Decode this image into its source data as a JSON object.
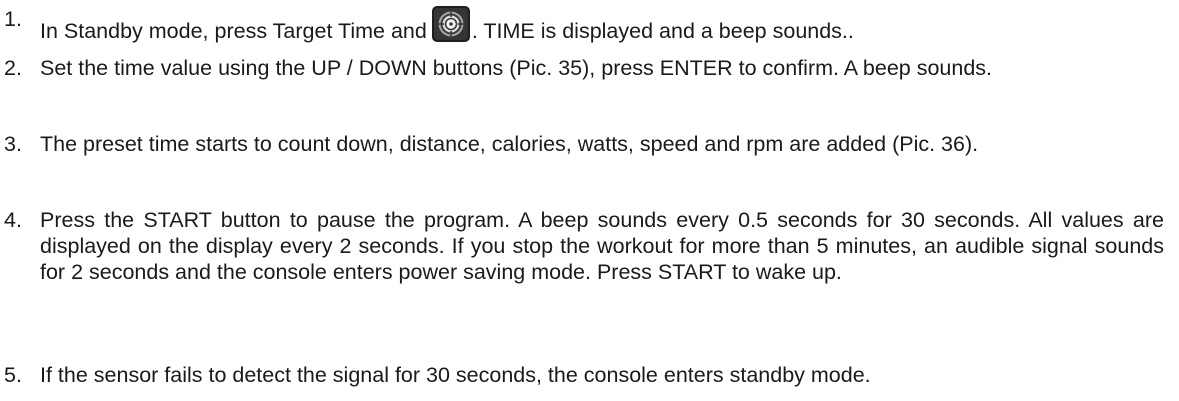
{
  "steps": [
    {
      "num": "1.",
      "text_before": "In Standby mode, press Target Time and",
      "icon": "target-button-icon",
      "text_after": ". TIME is displayed and a beep sounds.."
    },
    {
      "num": "2.",
      "text": "Set the time value using the UP / DOWN buttons (Pic. 35), press ENTER to confirm. A beep sounds."
    },
    {
      "num": "3.",
      "text": "The preset time starts to count down, distance, calories, watts, speed and rpm are added (Pic. 36)."
    },
    {
      "num": "4.",
      "text": "Press the START button to pause the program. A beep sounds every 0.5 seconds for 30 seconds. All values are displayed on the display every 2 seconds. If you stop the workout for more than 5 minutes, an audible signal sounds for 2 seconds and the console enters power saving mode. Press START to wake up."
    },
    {
      "num": "5.",
      "text": "If the sensor fails to detect the signal for 30 seconds, the console enters standby mode."
    }
  ]
}
